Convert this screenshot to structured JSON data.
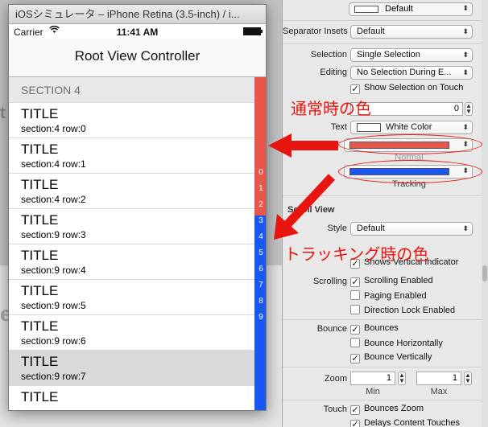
{
  "simulator": {
    "title": "iOSシミュレータ – iPhone Retina (3.5-inch) / i...",
    "status": {
      "carrier": "Carrier",
      "time": "11:41 AM"
    },
    "nav_title": "Root View Controller",
    "section_header": "SECTION 4",
    "rows": [
      {
        "title": "TITLE",
        "subtitle": "section:4 row:0"
      },
      {
        "title": "TITLE",
        "subtitle": "section:4 row:1"
      },
      {
        "title": "TITLE",
        "subtitle": "section:4 row:2"
      },
      {
        "title": "TITLE",
        "subtitle": "section:9 row:3"
      },
      {
        "title": "TITLE",
        "subtitle": "section:9 row:4"
      },
      {
        "title": "TITLE",
        "subtitle": "section:9 row:5"
      },
      {
        "title": "TITLE",
        "subtitle": "section:9 row:6"
      },
      {
        "title": "TITLE",
        "subtitle": "section:9 row:7"
      },
      {
        "title": "TITLE",
        "subtitle": ""
      }
    ],
    "selected_row_index": 7,
    "section_index": [
      "0",
      "1",
      "2",
      "3",
      "4",
      "5",
      "6",
      "7",
      "8",
      "9"
    ],
    "index_colors": {
      "normal": "#e8574c",
      "tracking": "#1a57f2"
    }
  },
  "inspector": {
    "top_popup": "Default",
    "separator_insets_label": "Separator Insets",
    "separator_insets_value": "Default",
    "selection_label": "Selection",
    "selection_value": "Single Selection",
    "editing_label": "Editing",
    "editing_value": "No Selection During E...",
    "show_selection_on_touch": "Show Selection on Touch",
    "min_value": "0",
    "text_label": "Text",
    "text_color_value": "White Color",
    "normal_caption": "Normal",
    "tracking_caption": "Tracking",
    "scroll_view_header": "Scroll View",
    "style_label": "Style",
    "style_value": "Default",
    "shows_vertical_indicator": "Shows Vertical Indicator",
    "scrolling_label": "Scrolling",
    "scrolling_enabled": "Scrolling Enabled",
    "paging_enabled": "Paging Enabled",
    "direction_lock_enabled": "Direction Lock Enabled",
    "bounce_label": "Bounce",
    "bounces": "Bounces",
    "bounce_horizontally": "Bounce Horizontally",
    "bounce_vertically": "Bounce Vertically",
    "zoom_label": "Zoom",
    "zoom_min": "1",
    "zoom_max": "1",
    "min_caption": "Min",
    "max_caption": "Max",
    "touch_label": "Touch",
    "bounces_zoom": "Bounces Zoom",
    "delays_content_touches": "Delays Content Touches"
  },
  "annotations": {
    "normal_color_label": "通常時の色",
    "tracking_color_label": "トラッキング時の色",
    "color": "#e8150f"
  }
}
